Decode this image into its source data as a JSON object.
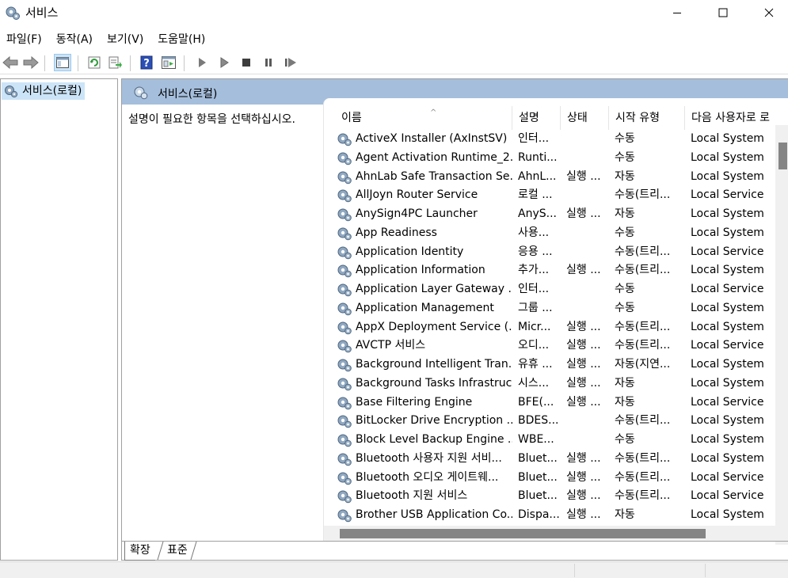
{
  "window": {
    "title": "서비스"
  },
  "menu": [
    "파일(F)",
    "동작(A)",
    "보기(V)",
    "도움말(H)"
  ],
  "toolbar": {
    "icons": [
      "back-arrow-icon",
      "forward-arrow-icon",
      "console-tree-icon",
      "refresh-icon",
      "export-list-icon",
      "help-icon",
      "properties-icon",
      "play-icon",
      "play-outline-icon",
      "stop-icon",
      "pause-icon",
      "restart-icon"
    ]
  },
  "tree": {
    "node_label": "서비스(로컬)"
  },
  "header": {
    "title": "서비스(로컬)"
  },
  "description_prompt": "설명이 필요한 항목을 선택하십시오.",
  "columns": {
    "name": "이름",
    "description": "설명",
    "status": "상태",
    "startup_type": "시작 유형",
    "logon_as": "다음 사용자로 로"
  },
  "services": [
    {
      "name": "ActiveX Installer (AxInstSV)",
      "description": "인터...",
      "status": "",
      "startup": "수동",
      "logon": "Local System"
    },
    {
      "name": "Agent Activation Runtime_2...",
      "description": "Runti...",
      "status": "",
      "startup": "수동",
      "logon": "Local System"
    },
    {
      "name": "AhnLab Safe Transaction Se...",
      "description": "AhnL...",
      "status": "실행 ...",
      "startup": "자동",
      "logon": "Local System"
    },
    {
      "name": "AllJoyn Router Service",
      "description": "로컬 ...",
      "status": "",
      "startup": "수동(트리...",
      "logon": "Local Service"
    },
    {
      "name": "AnySign4PC Launcher",
      "description": "AnyS...",
      "status": "실행 ...",
      "startup": "자동",
      "logon": "Local System"
    },
    {
      "name": "App Readiness",
      "description": "사용...",
      "status": "",
      "startup": "수동",
      "logon": "Local System"
    },
    {
      "name": "Application Identity",
      "description": "응용 ...",
      "status": "",
      "startup": "수동(트리...",
      "logon": "Local Service"
    },
    {
      "name": "Application Information",
      "description": "추가...",
      "status": "실행 ...",
      "startup": "수동(트리...",
      "logon": "Local System"
    },
    {
      "name": "Application Layer Gateway ...",
      "description": "인터...",
      "status": "",
      "startup": "수동",
      "logon": "Local Service"
    },
    {
      "name": "Application Management",
      "description": "그룹 ...",
      "status": "",
      "startup": "수동",
      "logon": "Local System"
    },
    {
      "name": "AppX Deployment Service (...",
      "description": "Micr...",
      "status": "실행 ...",
      "startup": "수동(트리...",
      "logon": "Local System"
    },
    {
      "name": "AVCTP 서비스",
      "description": "오디...",
      "status": "실행 ...",
      "startup": "수동(트리...",
      "logon": "Local Service"
    },
    {
      "name": "Background Intelligent Tran...",
      "description": "유휴 ...",
      "status": "실행 ...",
      "startup": "자동(지연...",
      "logon": "Local System"
    },
    {
      "name": "Background Tasks Infrastruc...",
      "description": "시스...",
      "status": "실행 ...",
      "startup": "자동",
      "logon": "Local System"
    },
    {
      "name": "Base Filtering Engine",
      "description": "BFE(...",
      "status": "실행 ...",
      "startup": "자동",
      "logon": "Local Service"
    },
    {
      "name": "BitLocker Drive Encryption ...",
      "description": "BDES...",
      "status": "",
      "startup": "수동(트리...",
      "logon": "Local System"
    },
    {
      "name": "Block Level Backup Engine ...",
      "description": "WBE...",
      "status": "",
      "startup": "수동",
      "logon": "Local System"
    },
    {
      "name": "Bluetooth 사용자 지원 서비...",
      "description": "Bluet...",
      "status": "실행 ...",
      "startup": "수동(트리...",
      "logon": "Local System"
    },
    {
      "name": "Bluetooth 오디오 게이트웨...",
      "description": "Bluet...",
      "status": "실행 ...",
      "startup": "수동(트리...",
      "logon": "Local Service"
    },
    {
      "name": "Bluetooth 지원 서비스",
      "description": "Bluet...",
      "status": "실행 ...",
      "startup": "수동(트리...",
      "logon": "Local Service"
    },
    {
      "name": "Brother USB Application Co...",
      "description": "Dispa...",
      "status": "실행 ...",
      "startup": "자동",
      "logon": "Local System"
    }
  ],
  "tabs": {
    "extended": "확장",
    "standard": "표준"
  }
}
